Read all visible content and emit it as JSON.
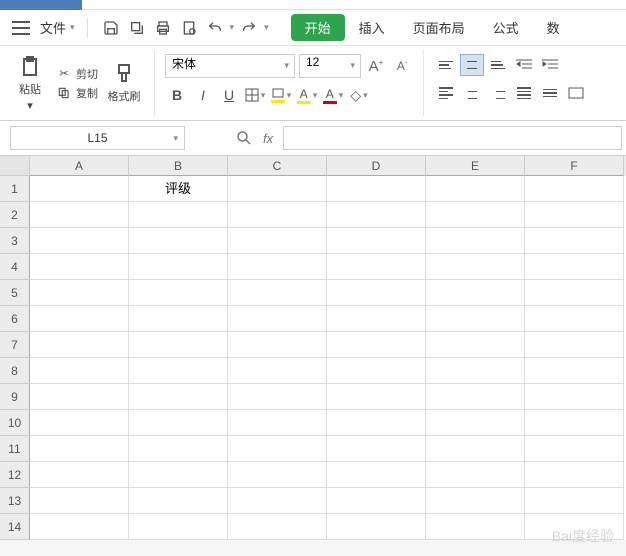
{
  "menu": {
    "file_label": "文件",
    "tabs": [
      "开始",
      "插入",
      "页面布局",
      "公式",
      "数"
    ],
    "active_tab": "开始"
  },
  "clipboard": {
    "paste_label": "粘贴",
    "cut_label": "剪切",
    "copy_label": "复制",
    "brush_label": "格式刷"
  },
  "font": {
    "name": "宋体",
    "size": "12",
    "increase_char": "A",
    "decrease_char": "A",
    "bold": "B",
    "italic": "I",
    "underline": "U",
    "font_color": "#d0021b",
    "highlight_color": "#f8e71c"
  },
  "namebox": {
    "ref": "L15",
    "fx": "fx"
  },
  "sheet": {
    "columns": [
      "A",
      "B",
      "C",
      "D",
      "E",
      "F"
    ],
    "rows": [
      1,
      2,
      3,
      4,
      5,
      6,
      7,
      8,
      9,
      10,
      11,
      12,
      13,
      14
    ],
    "cells": {
      "B1": "评级"
    }
  },
  "watermark": "Bai度经验"
}
